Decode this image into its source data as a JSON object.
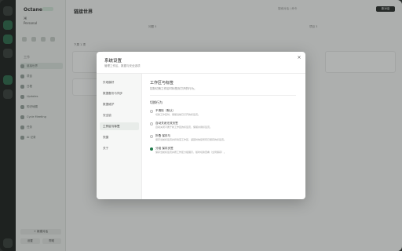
{
  "app": {
    "workspace_name": "Octane",
    "user_line1": "Ж",
    "user_line2": "Personal",
    "section_label": "工作",
    "main_title": "链接世界",
    "search_text": "搜索对话 / 命令",
    "main_button": "新对话",
    "tab_left": "问题 5",
    "tab_right": "项目 3",
    "sub_label": "下周 1 项"
  },
  "sidebar": {
    "items": [
      {
        "label": "链接世界"
      },
      {
        "label": "项目"
      },
      {
        "label": "日程"
      },
      {
        "label": "Updates"
      },
      {
        "label": "知识地图"
      },
      {
        "label": "Cycle Meeting"
      },
      {
        "label": "任务"
      },
      {
        "label": "AI 记录"
      }
    ],
    "new_button": "+ 新建对话",
    "bottom_left": "设置",
    "bottom_right": "帮助"
  },
  "modal": {
    "title": "系统设置",
    "subtitle": "管理工作区、数据与安全选项",
    "close_label": "×",
    "nav": [
      {
        "label": "外观偏好"
      },
      {
        "label": "数据备份与同步"
      },
      {
        "label": "数据维护"
      },
      {
        "label": "安全锁"
      },
      {
        "label": "工作区与标签"
      },
      {
        "label": "快捷"
      },
      {
        "label": "关于"
      }
    ],
    "active_nav": "工作区与标签",
    "pane": {
      "title": "工作区与标签",
      "desc": "控制切换工作区时标签页打开的行为。",
      "section": "切换行为",
      "options": [
        {
          "title": "不清除（默认）",
          "desc": "切换工作区时，保留当前已打开的标签页。",
          "selected": false
        },
        {
          "title": "自动关闭无效页签",
          "desc": "自动关闭不属于新工作区的标签页，保留共用标签页。",
          "selected": false
        },
        {
          "title": "折叠 保存与",
          "desc": "保存当前标签页并折叠至工作区，返回时恢复所有已保存的标签页。",
          "selected": false
        },
        {
          "title": "分组 保存页签",
          "desc": "保存当前标签页并按工作区分组展示，随时切换查看（全局保存）。",
          "selected": true
        }
      ]
    }
  },
  "colors": {
    "accent": "#1f7a4a",
    "rail": "#1f2321",
    "sidebar": "#f3f4f3"
  }
}
